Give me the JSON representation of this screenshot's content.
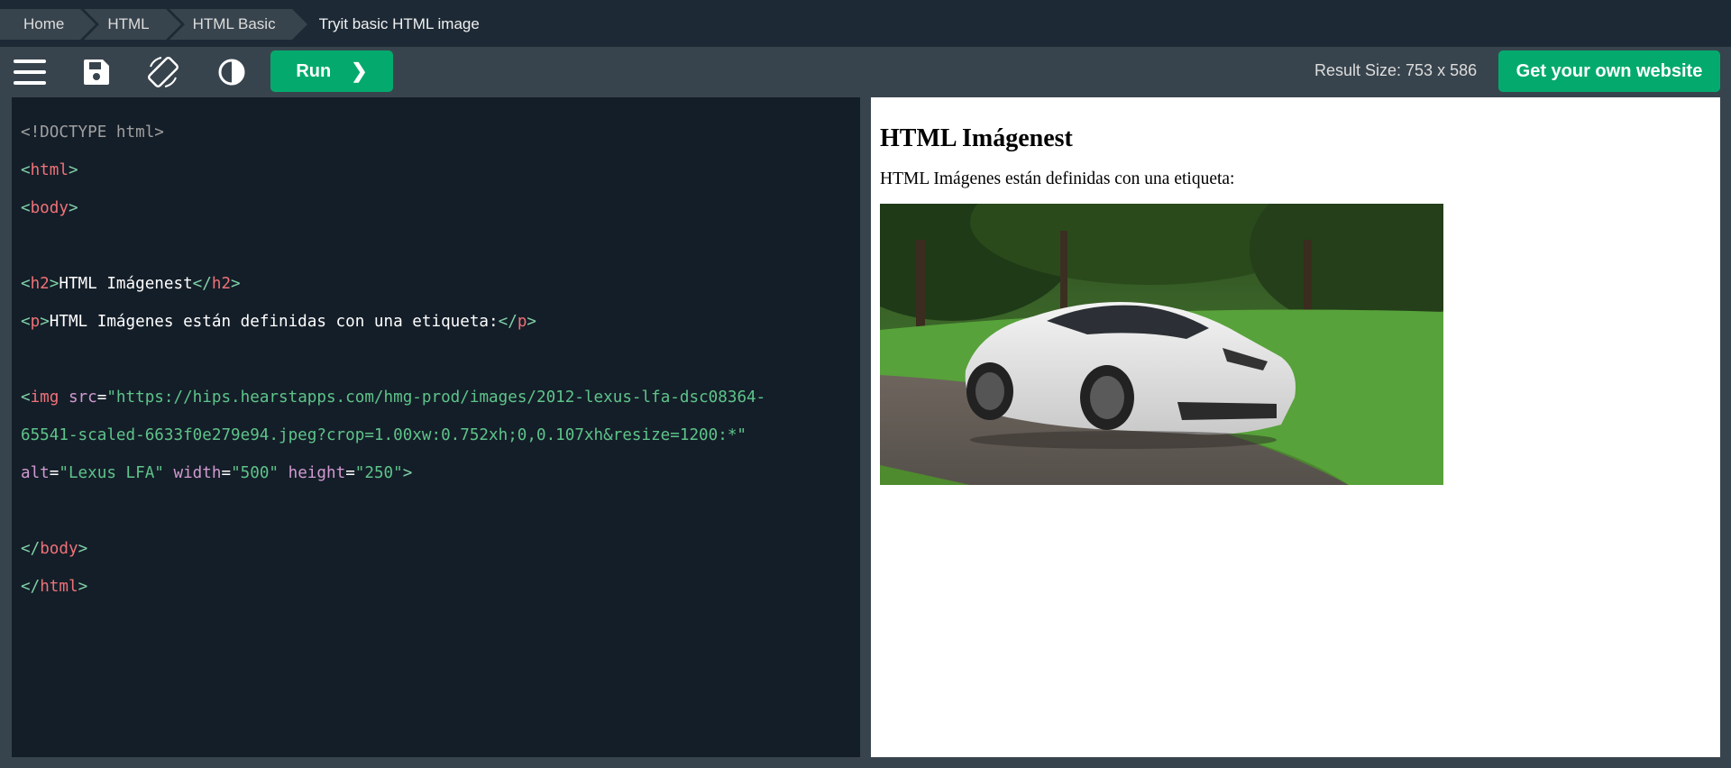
{
  "breadcrumb": {
    "items": [
      "Home",
      "HTML",
      "HTML Basic"
    ],
    "current": "Tryit basic HTML image"
  },
  "toolbar": {
    "icons": [
      "menu-icon",
      "save-icon",
      "rotate-icon",
      "contrast-icon"
    ],
    "run_label": "Run",
    "run_arrow": "❯",
    "result_size": "Result Size: 753 x 586",
    "get_website_label": "Get your own website"
  },
  "editor": {
    "lines": {
      "l1": "<!DOCTYPE html>",
      "l2_open": "<",
      "l2_tag": "html",
      "l2_close": ">",
      "l3_open": "<",
      "l3_tag": "body",
      "l3_close": ">",
      "l5_open1": "<",
      "l5_tag1": "h2",
      "l5_close1": ">",
      "l5_text": "HTML Imágenest",
      "l5_open2": "</",
      "l5_tag2": "h2",
      "l5_close2": ">",
      "l6_open1": "<",
      "l6_tag1": "p",
      "l6_close1": ">",
      "l6_text": "HTML Imágenes están definidas con una etiqueta:",
      "l6_open2": "</",
      "l6_tag2": "p",
      "l6_close2": ">",
      "l8_open": "<",
      "l8_tag": "img",
      "l8_attr": " src",
      "l8_eq": "=",
      "l8_str": "\"https://hips.hearstapps.com/hmg-prod/images/2012-lexus-lfa-dsc08364-",
      "l9_str": "65541-scaled-6633f0e279e94.jpeg?crop=1.00xw:0.752xh;0,0.107xh&resize=1200:*\"",
      "l10_attr1": "alt",
      "l10_eq1": "=",
      "l10_str1": "\"Lexus LFA\"",
      "l10_attr2": " width",
      "l10_eq2": "=",
      "l10_str2": "\"500\"",
      "l10_attr3": " height",
      "l10_eq3": "=",
      "l10_str3": "\"250\"",
      "l10_close": ">",
      "l12_open": "</",
      "l12_tag": "body",
      "l12_close": ">",
      "l13_open": "</",
      "l13_tag": "html",
      "l13_close": ">"
    }
  },
  "result": {
    "heading": "HTML Imágenest",
    "paragraph": "HTML Imágenes están definidas con una etiqueta:",
    "image_alt": "Lexus LFA"
  },
  "colors": {
    "accent": "#04aa6d",
    "toolbar_bg": "#38444d",
    "breadcrumb_bg": "#1d2a35",
    "editor_bg": "#141e28"
  }
}
